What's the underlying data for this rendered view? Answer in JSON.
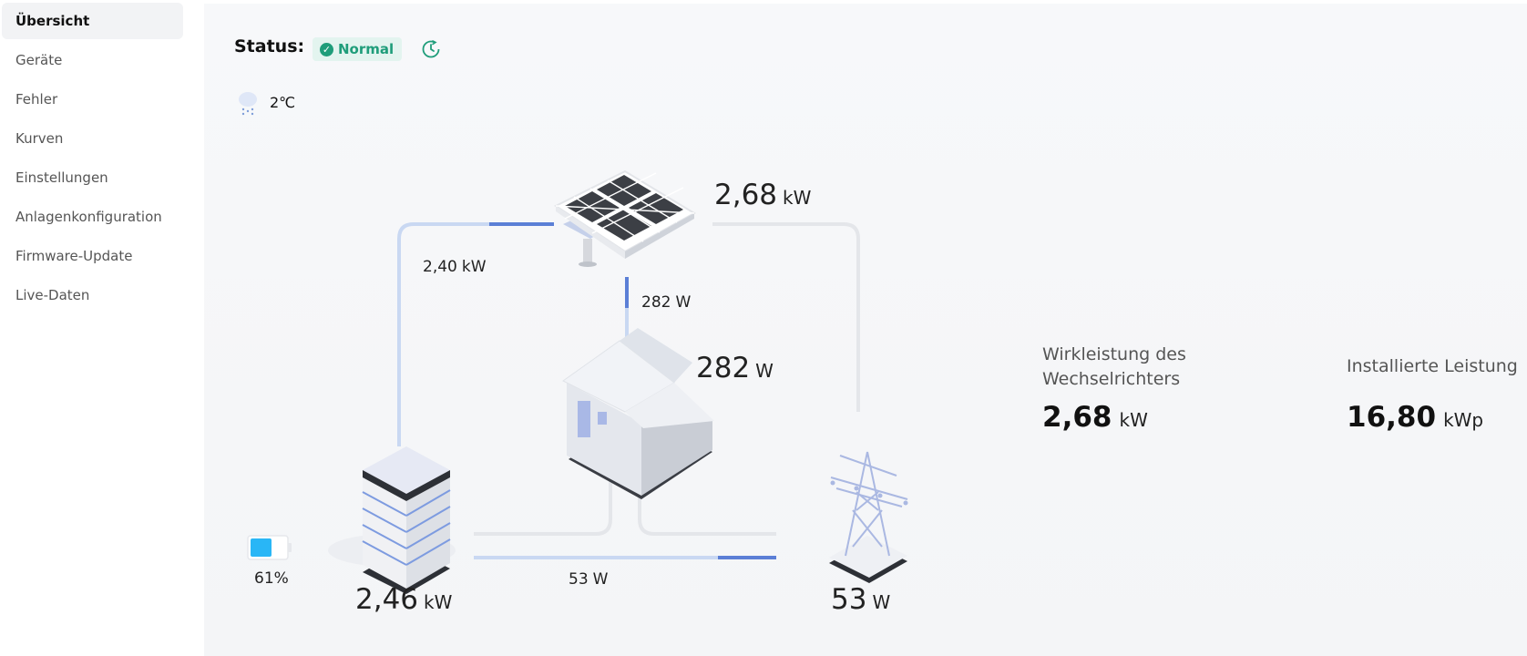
{
  "sidebar": {
    "items": [
      {
        "label": "Übersicht",
        "active": true
      },
      {
        "label": "Geräte"
      },
      {
        "label": "Fehler"
      },
      {
        "label": "Kurven"
      },
      {
        "label": "Einstellungen"
      },
      {
        "label": "Anlagenkonfiguration"
      },
      {
        "label": "Firmware-Update"
      },
      {
        "label": "Live-Daten"
      }
    ]
  },
  "status": {
    "label": "Status:",
    "value": "Normal",
    "color": "#1f9d7a"
  },
  "weather": {
    "icon": "snow-rain-cloud-icon",
    "temperature": "2℃"
  },
  "flows": {
    "pv_total": {
      "value": "2,68",
      "unit": "kW"
    },
    "pv_to_battery": {
      "value": "2,40",
      "unit": "kW"
    },
    "pv_to_house": {
      "value": "282",
      "unit": "W"
    },
    "house": {
      "value": "282",
      "unit": "W"
    },
    "battery": {
      "value": "2,46",
      "unit": "kW",
      "soc": "61%",
      "soc_fraction": 0.61
    },
    "battery_to_grid": {
      "value": "53",
      "unit": "W"
    },
    "grid": {
      "value": "53",
      "unit": "W"
    }
  },
  "stats": {
    "inverter_power": {
      "label_line1": "Wirkleistung des",
      "label_line2": "Wechselrichters",
      "value": "2,68",
      "unit": "kW"
    },
    "installed_power": {
      "label": "Installierte Leistung",
      "value": "16,80",
      "unit": "kWp"
    }
  },
  "colors": {
    "accent": "#5b7fd6",
    "line_light": "#c9d8f2",
    "line_gray": "#e4e6ea",
    "battery_fill": "#29b6f6"
  }
}
